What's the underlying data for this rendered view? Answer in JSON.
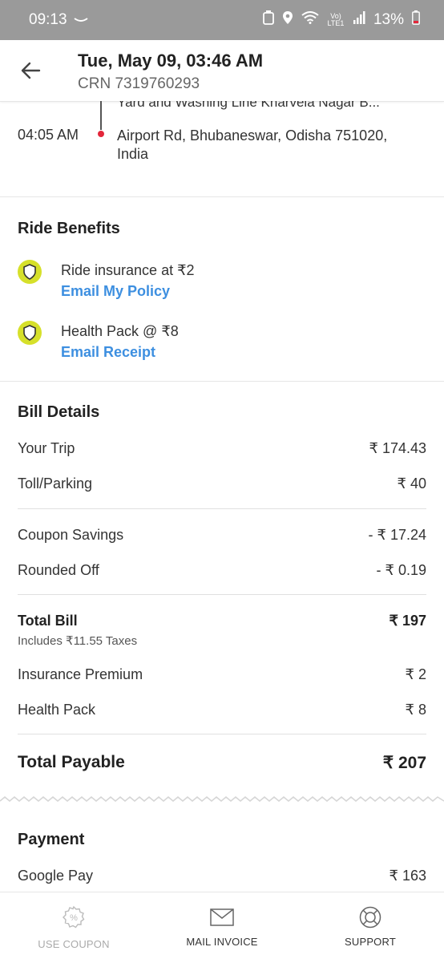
{
  "status_bar": {
    "time": "09:13",
    "battery": "13%",
    "network": "Vo) LTE1"
  },
  "header": {
    "title": "Tue, May 09, 03:46 AM",
    "crn": "CRN 7319760293",
    "back_icon": "arrow-left-icon"
  },
  "route": {
    "pickup_partial": "Yard and Washing Line Kharvela Nagar B...",
    "drop_time": "04:05 AM",
    "drop_address": "Airport Rd, Bhubaneswar, Odisha 751020, India"
  },
  "ride_benefits": {
    "title": "Ride Benefits",
    "items": [
      {
        "label": "Ride insurance at ₹2",
        "link": "Email My Policy",
        "icon": "shield-icon"
      },
      {
        "label": "Health Pack @ ₹8",
        "link": "Email Receipt",
        "icon": "shield-icon"
      }
    ]
  },
  "bill": {
    "title": "Bill Details",
    "your_trip": {
      "label": "Your Trip",
      "value": "₹ 174.43"
    },
    "toll": {
      "label": "Toll/Parking",
      "value": "₹ 40"
    },
    "coupon": {
      "label": "Coupon Savings",
      "value": "- ₹ 17.24"
    },
    "rounded": {
      "label": "Rounded Off",
      "value": "- ₹ 0.19"
    },
    "total_bill": {
      "label": "Total Bill",
      "value": "₹ 197",
      "taxes": "Includes ₹11.55 Taxes"
    },
    "insurance": {
      "label": "Insurance Premium",
      "value": "₹ 2"
    },
    "health": {
      "label": "Health Pack",
      "value": "₹ 8"
    },
    "total_payable": {
      "label": "Total Payable",
      "value": "₹ 207"
    }
  },
  "payment": {
    "title": "Payment",
    "method": "Google Pay",
    "amount": "₹ 163"
  },
  "bottom_bar": {
    "use_coupon": "USE COUPON",
    "mail_invoice": "MAIL INVOICE",
    "support": "SUPPORT"
  },
  "colors": {
    "accent_link": "#3d8fe0",
    "shield_bg": "#d6e02a",
    "route_dot": "#e3263a",
    "status_bar_bg": "#9a9a9a"
  }
}
